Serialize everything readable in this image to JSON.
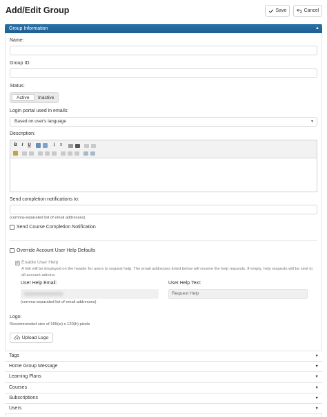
{
  "header": {
    "title": "Add/Edit Group",
    "save_label": "Save",
    "cancel_label": "Cancel"
  },
  "panel": {
    "title": "Group Information"
  },
  "fields": {
    "name_label": "Name:",
    "group_id_label": "Group ID:",
    "status_label": "Status:",
    "status_options": [
      "Active",
      "Inactive"
    ],
    "status_selected": "Active",
    "login_portal_label": "Login portal used in emails:",
    "login_portal_value": "Based on user's language",
    "description_label": "Description:",
    "send_completion_label": "Send completion notifications to:",
    "send_completion_hint": "(comma-separated list of email addresses)",
    "send_course_completion_label": "Send Course Completion Notification",
    "override_help_label": "Override Account User Help Defaults",
    "enable_help_label": "Enable User Help",
    "enable_help_desc": "A link will be displayed on the header for users to request help. The email addresses listed below will receive the help requests. If empty, help requests will be sent to all account admins.",
    "user_help_email_label": "User Help Email:",
    "user_help_email_hint": "(comma-separated list of email addresses)",
    "user_help_text_label": "User Help Text:",
    "user_help_text_value": "Request Help",
    "logo_label": "Logo:",
    "logo_hint": "Recommended size of 165(w) x 120(h) pixels",
    "upload_logo_label": "Upload Logo"
  },
  "sections": [
    {
      "label": "Tags"
    },
    {
      "label": "Home Group Message"
    },
    {
      "label": "Learning Plans"
    },
    {
      "label": "Courses"
    },
    {
      "label": "Subscriptions"
    },
    {
      "label": "Users"
    }
  ],
  "colors": {
    "panel_header": "#1f5f92"
  }
}
